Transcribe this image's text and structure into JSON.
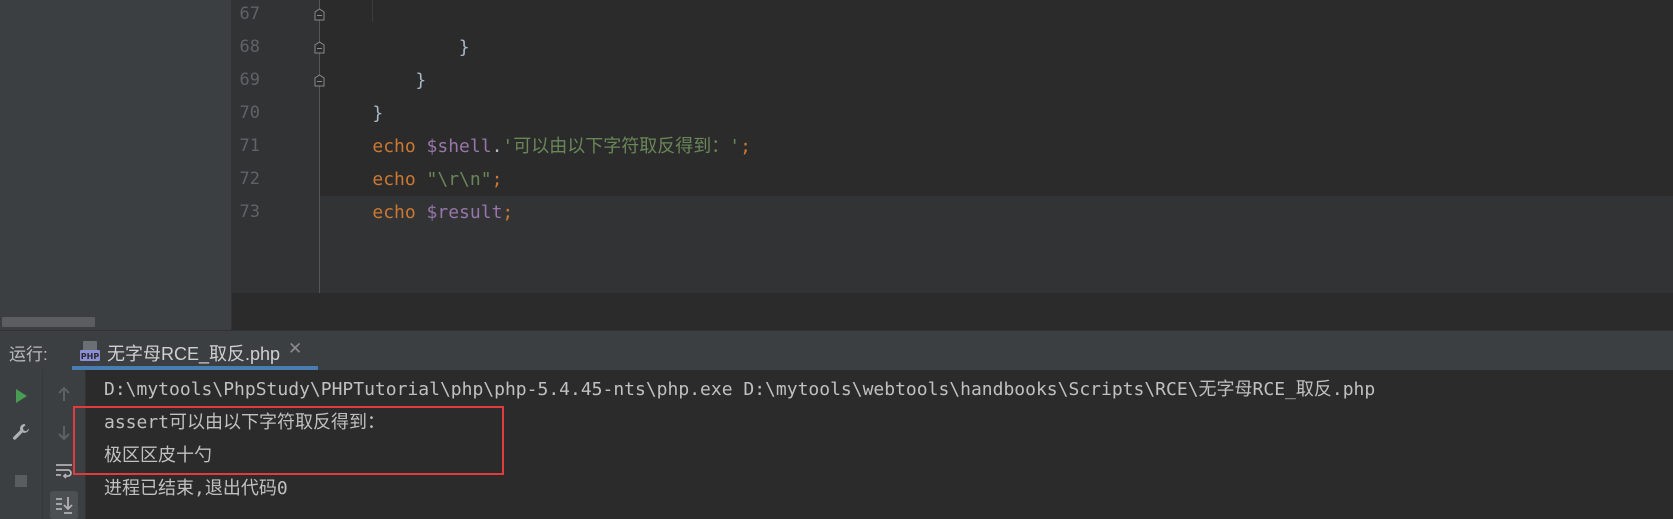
{
  "editor": {
    "lines": [
      {
        "num": "67",
        "segments": [
          {
            "t": "    }",
            "c": "plain"
          }
        ]
      },
      {
        "num": "68",
        "segments": [
          {
            "t": "}",
            "c": "plain"
          }
        ]
      },
      {
        "num": "69",
        "segments": [
          {
            "t": "}",
            "c": "plain"
          }
        ]
      },
      {
        "num": "70",
        "segments": [
          {
            "t": "echo ",
            "c": "kw"
          },
          {
            "t": "$shell",
            "c": "var"
          },
          {
            "t": ".",
            "c": "plain"
          },
          {
            "t": "'可以由以下字符取反得到：'",
            "c": "str"
          },
          {
            "t": ";",
            "c": "punc"
          }
        ]
      },
      {
        "num": "71",
        "segments": [
          {
            "t": "echo ",
            "c": "kw"
          },
          {
            "t": "\"\\r\\n\"",
            "c": "str"
          },
          {
            "t": ";",
            "c": "punc"
          }
        ]
      },
      {
        "num": "72",
        "segments": [
          {
            "t": "echo ",
            "c": "kw"
          },
          {
            "t": "$result",
            "c": "var"
          },
          {
            "t": ";",
            "c": "punc"
          }
        ]
      },
      {
        "num": "73",
        "segments": []
      }
    ]
  },
  "run": {
    "label": "运行:",
    "tab_title": "无字母RCE_取反.php",
    "tab_close": "✕",
    "console_lines": [
      "D:\\mytools\\PhpStudy\\PHPTutorial\\php\\php-5.4.45-nts\\php.exe D:\\mytools\\webtools\\handbooks\\Scripts\\RCE\\无字母RCE_取反.php",
      "assert可以由以下字符取反得到：",
      "极区区皮十勺",
      "进程已结束,退出代码0"
    ]
  },
  "icons": {
    "run": "run-icon",
    "wrench": "wrench-icon",
    "stop": "stop-icon",
    "up": "arrow-up-icon",
    "down": "arrow-down-icon",
    "wrap": "soft-wrap-icon",
    "scroll_end": "scroll-to-end-icon",
    "php_file": "php-file-icon"
  },
  "colors": {
    "keyword": "#cc7832",
    "variable": "#9876aa",
    "string": "#6a8759",
    "run_green": "#499c54",
    "highlight_red": "#e03c3c"
  }
}
